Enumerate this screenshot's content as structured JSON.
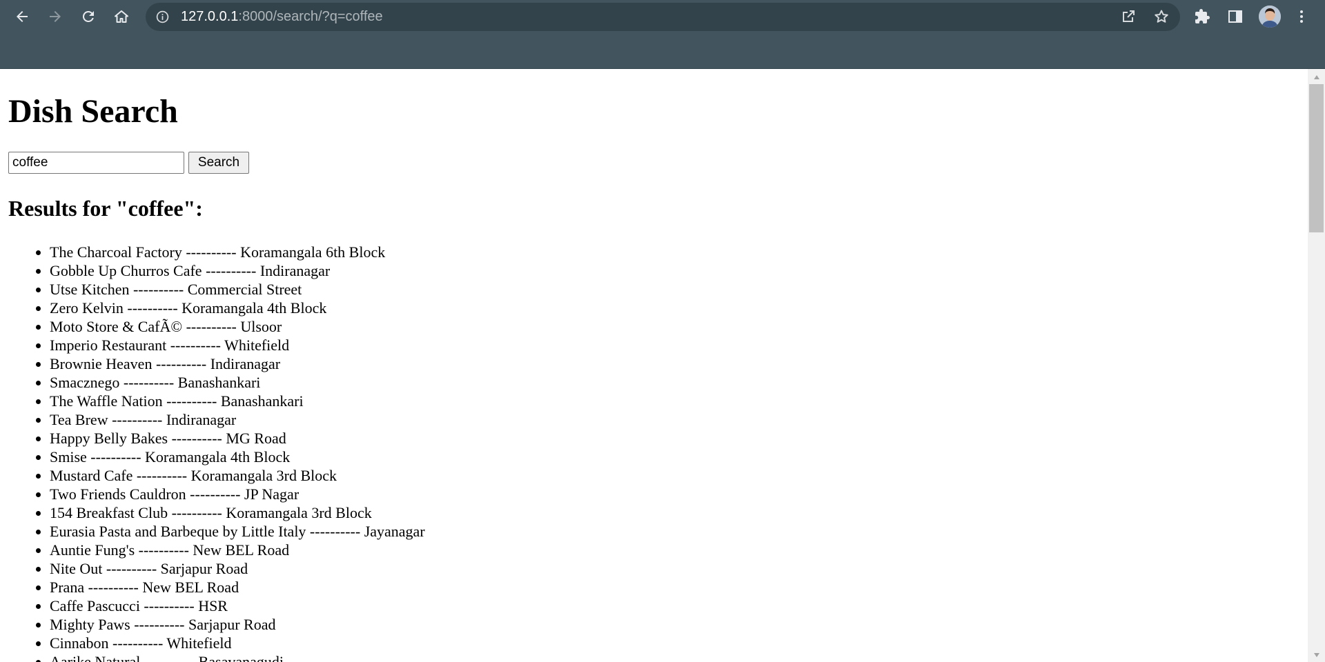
{
  "browser": {
    "url_host": "127.0.0.1",
    "url_rest": ":8000/search/?q=coffee",
    "icons": {
      "back": "back-arrow-icon",
      "forward": "forward-arrow-icon",
      "reload": "reload-icon",
      "home": "home-icon",
      "info": "info-icon",
      "share": "share-icon",
      "bookmark": "star-icon",
      "extensions": "puzzle-icon",
      "side_panel": "side-panel-icon",
      "profile": "avatar",
      "menu": "kebab-menu-icon"
    },
    "colors": {
      "toolbar": "#42555f",
      "omnibox": "#33434b"
    }
  },
  "page": {
    "title": "Dish Search",
    "search": {
      "value": "coffee",
      "button_label": "Search"
    },
    "results_heading": "Results for \"coffee\":",
    "results": [
      "The Charcoal Factory ---------- Koramangala 6th Block",
      "Gobble Up Churros Cafe ---------- Indiranagar",
      "Utse Kitchen ---------- Commercial Street",
      "Zero Kelvin ---------- Koramangala 4th Block",
      "Moto Store & CafÃ© ---------- Ulsoor",
      "Imperio Restaurant ---------- Whitefield",
      "Brownie Heaven ---------- Indiranagar",
      "Smacznego ---------- Banashankari",
      "The Waffle Nation ---------- Banashankari",
      "Tea Brew ---------- Indiranagar",
      "Happy Belly Bakes ---------- MG Road",
      "Smise ---------- Koramangala 4th Block",
      "Mustard Cafe ---------- Koramangala 3rd Block",
      "Two Friends Cauldron ---------- JP Nagar",
      "154 Breakfast Club ---------- Koramangala 3rd Block",
      "Eurasia Pasta and Barbeque by Little Italy ---------- Jayanagar",
      "Auntie Fung's ---------- New BEL Road",
      "Nite Out ---------- Sarjapur Road",
      "Prana ---------- New BEL Road",
      "Caffe Pascucci ---------- HSR",
      "Mighty Paws ---------- Sarjapur Road",
      "Cinnabon ---------- Whitefield",
      "Aarike Natural ---------- Basavanagudi"
    ]
  }
}
